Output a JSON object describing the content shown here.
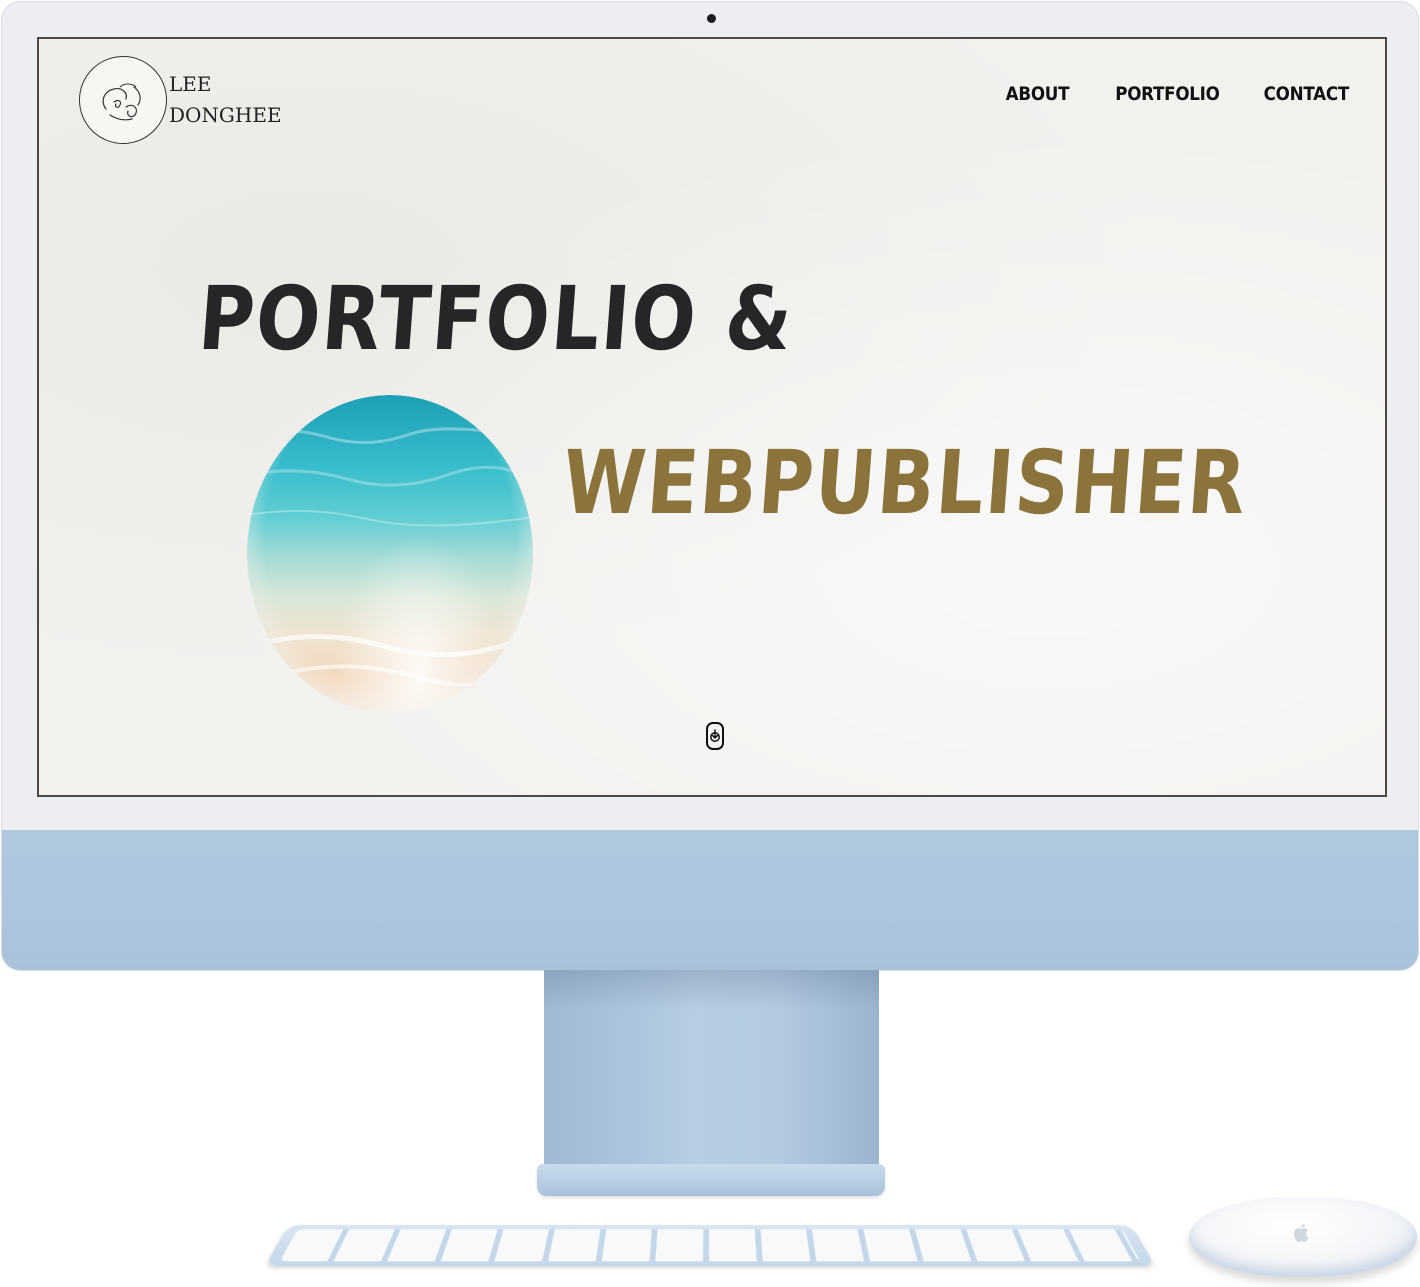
{
  "site": {
    "logo_line1": "LEE",
    "logo_line2": "DONGHEE"
  },
  "nav": {
    "items": [
      {
        "label": "ABOUT"
      },
      {
        "label": "PORTFOLIO"
      },
      {
        "label": "CONTACT"
      }
    ]
  },
  "hero": {
    "line1": "PORTFOLIO &",
    "line2": "WEBPUBLISHER"
  },
  "icons": {
    "logo": "face-sketch-icon",
    "scroll": "scroll-down-icon",
    "camera": "camera-icon",
    "mouse_brand": "apple-logo-icon"
  },
  "colors": {
    "accent": "#8a743c",
    "text": "#262626",
    "device": "#adc6dd"
  }
}
